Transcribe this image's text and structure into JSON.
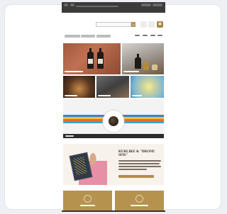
{
  "promo": {
    "title": "KURLIKE & \"DRONE SPIS\""
  }
}
